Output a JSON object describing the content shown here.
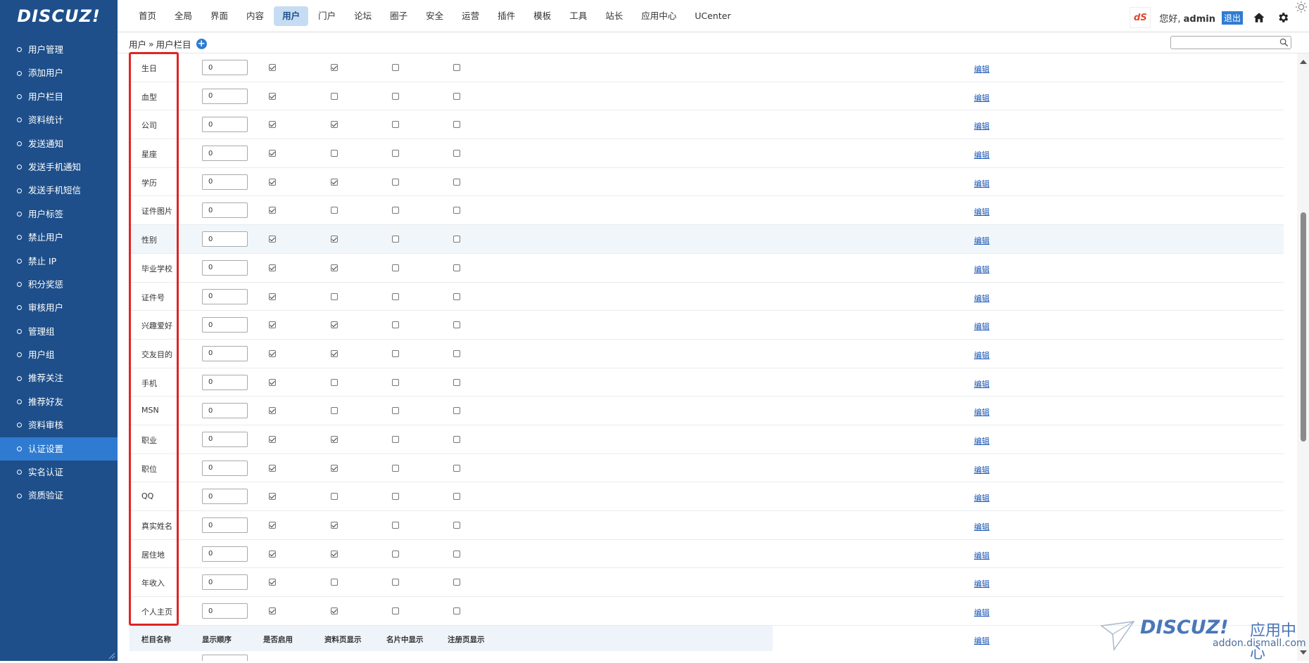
{
  "app": {
    "logo": "DISCUZ!",
    "brand_badge": "dS",
    "greeting_prefix": "您好,",
    "username": "admin",
    "logout": "退出"
  },
  "nav": [
    {
      "label": "首页"
    },
    {
      "label": "全局"
    },
    {
      "label": "界面"
    },
    {
      "label": "内容"
    },
    {
      "label": "用户",
      "active": true
    },
    {
      "label": "门户"
    },
    {
      "label": "论坛"
    },
    {
      "label": "圈子"
    },
    {
      "label": "安全"
    },
    {
      "label": "运营"
    },
    {
      "label": "插件"
    },
    {
      "label": "模板"
    },
    {
      "label": "工具"
    },
    {
      "label": "站长"
    },
    {
      "label": "应用中心"
    },
    {
      "label": "UCenter"
    }
  ],
  "sidebar": [
    {
      "label": "用户管理"
    },
    {
      "label": "添加用户"
    },
    {
      "label": "用户栏目"
    },
    {
      "label": "资料统计"
    },
    {
      "label": "发送通知"
    },
    {
      "label": "发送手机通知"
    },
    {
      "label": "发送手机短信"
    },
    {
      "label": "用户标签"
    },
    {
      "label": "禁止用户"
    },
    {
      "label": "禁止 IP"
    },
    {
      "label": "积分奖惩"
    },
    {
      "label": "审核用户"
    },
    {
      "label": "管理组"
    },
    {
      "label": "用户组"
    },
    {
      "label": "推荐关注"
    },
    {
      "label": "推荐好友"
    },
    {
      "label": "资料审核"
    },
    {
      "label": "认证设置",
      "active": true
    },
    {
      "label": "实名认证"
    },
    {
      "label": "资质验证"
    }
  ],
  "breadcrumb": {
    "section": "用户",
    "sep": "»",
    "page": "用户栏目"
  },
  "search": {
    "value": "",
    "placeholder": ""
  },
  "table": {
    "headers": [
      "栏目名称",
      "显示顺序",
      "是否启用",
      "资料页显示",
      "名片中显示",
      "注册页显示"
    ],
    "edit_label": "编辑",
    "rows": [
      {
        "name": "生日",
        "order": "0",
        "enabled": true,
        "profile": true,
        "card": false,
        "register": false
      },
      {
        "name": "血型",
        "order": "0",
        "enabled": true,
        "profile": false,
        "card": false,
        "register": false
      },
      {
        "name": "公司",
        "order": "0",
        "enabled": true,
        "profile": true,
        "card": false,
        "register": false
      },
      {
        "name": "星座",
        "order": "0",
        "enabled": true,
        "profile": false,
        "card": false,
        "register": false
      },
      {
        "name": "学历",
        "order": "0",
        "enabled": true,
        "profile": true,
        "card": false,
        "register": false
      },
      {
        "name": "证件图片",
        "order": "0",
        "enabled": true,
        "profile": false,
        "card": false,
        "register": false
      },
      {
        "name": "性别",
        "order": "0",
        "enabled": true,
        "profile": true,
        "card": false,
        "register": false,
        "highlight": true
      },
      {
        "name": "毕业学校",
        "order": "0",
        "enabled": true,
        "profile": true,
        "card": false,
        "register": false
      },
      {
        "name": "证件号",
        "order": "0",
        "enabled": true,
        "profile": false,
        "card": false,
        "register": false
      },
      {
        "name": "兴趣爱好",
        "order": "0",
        "enabled": true,
        "profile": true,
        "card": false,
        "register": false
      },
      {
        "name": "交友目的",
        "order": "0",
        "enabled": true,
        "profile": true,
        "card": false,
        "register": false
      },
      {
        "name": "手机",
        "order": "0",
        "enabled": true,
        "profile": false,
        "card": false,
        "register": false
      },
      {
        "name": "MSN",
        "order": "0",
        "enabled": true,
        "profile": false,
        "card": false,
        "register": false
      },
      {
        "name": "职业",
        "order": "0",
        "enabled": true,
        "profile": true,
        "card": false,
        "register": false
      },
      {
        "name": "职位",
        "order": "0",
        "enabled": true,
        "profile": true,
        "card": false,
        "register": false
      },
      {
        "name": "QQ",
        "order": "0",
        "enabled": true,
        "profile": false,
        "card": false,
        "register": false
      },
      {
        "name": "真实姓名",
        "order": "0",
        "enabled": true,
        "profile": true,
        "card": false,
        "register": false
      },
      {
        "name": "居住地",
        "order": "0",
        "enabled": true,
        "profile": true,
        "card": false,
        "register": false
      },
      {
        "name": "年收入",
        "order": "0",
        "enabled": true,
        "profile": false,
        "card": false,
        "register": false
      },
      {
        "name": "个人主页",
        "order": "0",
        "enabled": true,
        "profile": true,
        "card": false,
        "register": false
      }
    ]
  },
  "watermark": {
    "logo": "DISCUZ!",
    "label": "应用中心",
    "url": "addon.dismall.com"
  },
  "colors": {
    "sidebar_bg": "#1e4f8a",
    "sidebar_active": "#2f7bd1",
    "nav_active": "#c6dcf3",
    "highlight_box": "#e02424"
  }
}
